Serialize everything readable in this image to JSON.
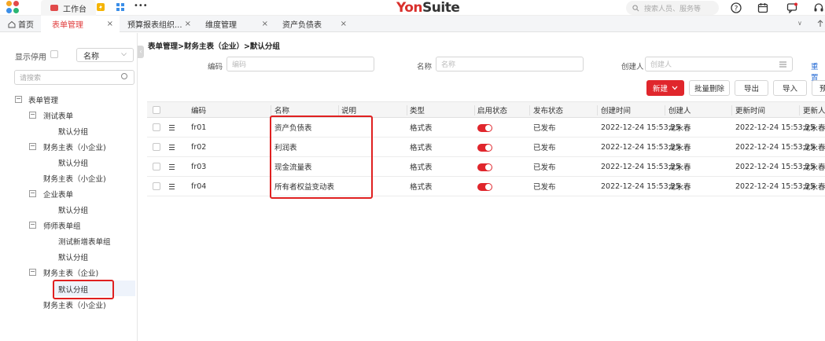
{
  "topbar": {
    "workbench_label": "工作台",
    "more_label": "•••",
    "brand_you": "Yon",
    "brand_suite": "Suite",
    "search_placeholder": "搜索人员、服务等"
  },
  "tabs": [
    {
      "label": "首页",
      "icon": "home-icon"
    },
    {
      "label": "表单管理",
      "close": "×"
    },
    {
      "label": "预算报表组织...",
      "close": "×"
    },
    {
      "label": "维度管理",
      "close": "×"
    },
    {
      "label": "资产负债表",
      "close": "×"
    }
  ],
  "tabbar_right": "∨",
  "sidebar": {
    "show_disabled_label": "显示停用",
    "select_value": "名称",
    "search_placeholder": "请搜索",
    "tree": [
      {
        "label": "表单管理",
        "toggle": "−"
      },
      {
        "label": "测试表单",
        "toggle": "−"
      },
      {
        "label": "默认分组"
      },
      {
        "label": "财务主表（小企业)",
        "toggle": "−"
      },
      {
        "label": "默认分组"
      },
      {
        "label": "财务主表（小企业)"
      },
      {
        "label": "企业表单",
        "toggle": "−"
      },
      {
        "label": "默认分组"
      },
      {
        "label": "师师表单组",
        "toggle": "−"
      },
      {
        "label": "测试新增表单组"
      },
      {
        "label": "默认分组"
      },
      {
        "label": "财务主表（企业)",
        "toggle": "−"
      },
      {
        "label": "默认分组"
      },
      {
        "label": "财务主表（小企业)"
      }
    ]
  },
  "main": {
    "breadcrumb": "表单管理>财务主表（企业）>默认分组",
    "filters": {
      "code_label": "编码",
      "code_placeholder": "编码",
      "name_label": "名称",
      "name_placeholder": "名称",
      "creator_label": "创建人",
      "creator_placeholder": "创建人",
      "reset_label": "重置"
    },
    "toolbar": {
      "new_label": "新建",
      "batch_delete_label": "批量删除",
      "export_label": "导出",
      "import_label": "导入",
      "preview_label": "预"
    },
    "columns": [
      "编码",
      "名称",
      "说明",
      "类型",
      "启用状态",
      "发布状态",
      "创建时间",
      "创建人",
      "更新时间",
      "更新人"
    ],
    "rows": [
      {
        "code": "fr01",
        "name": "资产负债表",
        "desc": "",
        "type": "格式表",
        "enabled": true,
        "publish": "已发布",
        "created": "2022-12-24 15:53:25",
        "creator": "龙永春",
        "updated": "2022-12-24 15:53:25",
        "updater": "龙永春"
      },
      {
        "code": "fr02",
        "name": "利润表",
        "desc": "",
        "type": "格式表",
        "enabled": true,
        "publish": "已发布",
        "created": "2022-12-24 15:53:25",
        "creator": "龙永春",
        "updated": "2022-12-24 15:53:25",
        "updater": "龙永春"
      },
      {
        "code": "fr03",
        "name": "现金流量表",
        "desc": "",
        "type": "格式表",
        "enabled": true,
        "publish": "已发布",
        "created": "2022-12-24 15:53:25",
        "creator": "龙永春",
        "updated": "2022-12-24 15:53:25",
        "updater": "龙永春"
      },
      {
        "code": "fr04",
        "name": "所有者权益变动表",
        "desc": "",
        "type": "格式表",
        "enabled": true,
        "publish": "已发布",
        "created": "2022-12-24 15:53:25",
        "creator": "龙永春",
        "updated": "2022-12-24 15:53:25",
        "updater": "龙永春"
      }
    ]
  },
  "colors": {
    "accent": "#e0262c",
    "highlight_box": "#e02020",
    "link": "#2b6fd6"
  }
}
